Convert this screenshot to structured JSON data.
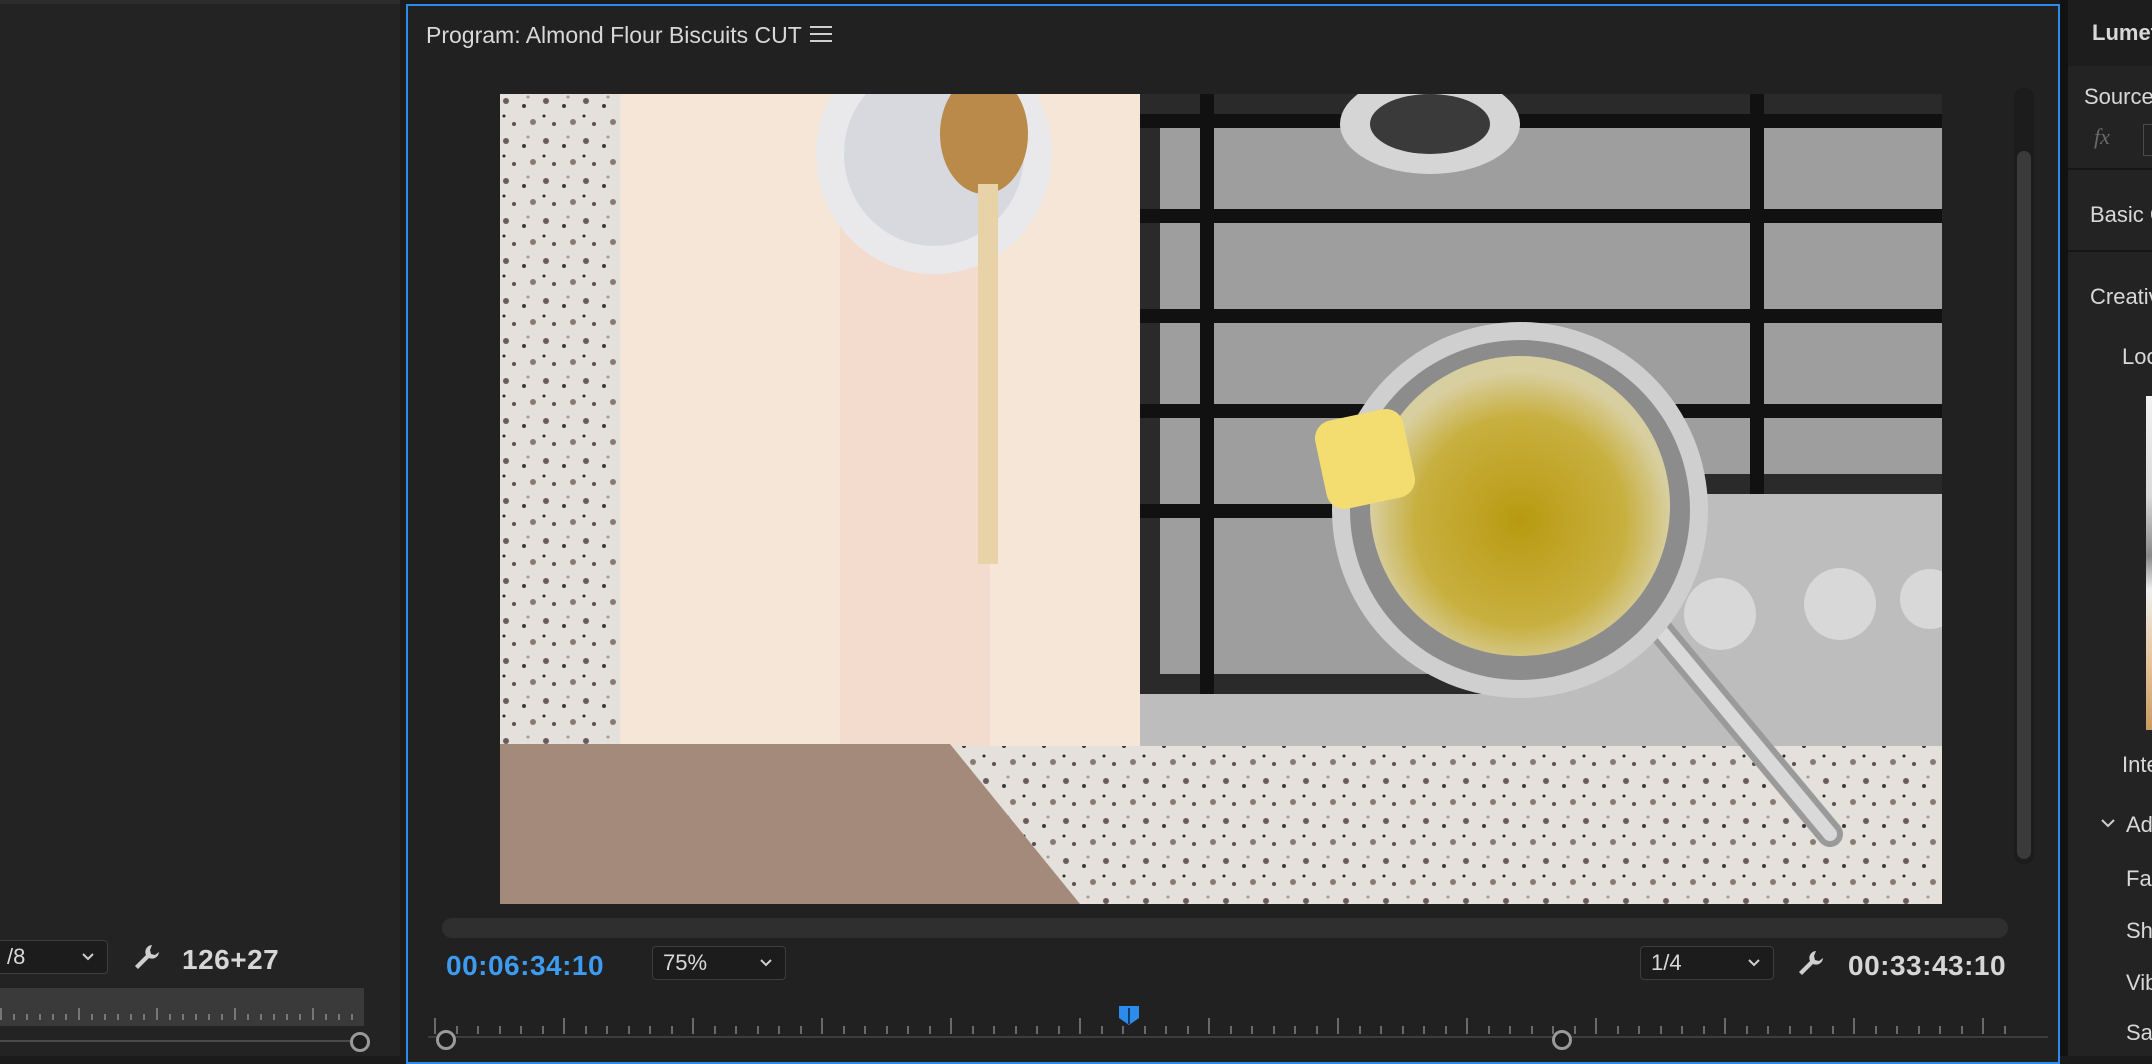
{
  "left_panel": {
    "resolution_value": "/8",
    "timecode": "126+27"
  },
  "program_monitor": {
    "title": "Program: Almond Flour Biscuits CUT",
    "current_timecode": "00:06:34:10",
    "zoom_value": "75%",
    "resolution_value": "1/4",
    "duration_timecode": "00:33:43:10",
    "playhead_fraction": 0.44
  },
  "lumetri": {
    "title": "Lumet",
    "source_label": "Source",
    "fx_label": "fx",
    "basic_label": "Basic C",
    "creative_label": "Creativ",
    "look_label": "Loo",
    "intensity_label": "Inte",
    "adjustments_label": "Adj",
    "faded_label": "Fac",
    "sharpen_label": "Sha",
    "vibrance_label": "Vib",
    "saturation_label": "Sat"
  },
  "colors": {
    "accent": "#2d8ceb",
    "timecode_blue": "#3d9bf0",
    "panel_bg": "#212121"
  }
}
